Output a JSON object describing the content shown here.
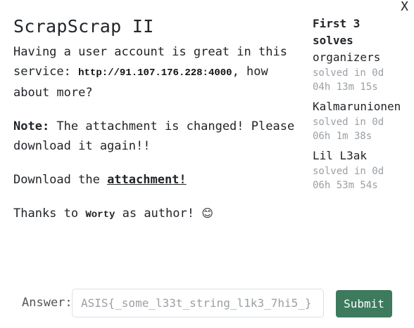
{
  "close_label": "X",
  "challenge": {
    "title": "ScrapScrap II",
    "intro_before": "Having a user account is great in this service: ",
    "service_url": "http://91.107.176.228:4000",
    "intro_after": ", how about more?",
    "note_label": "Note:",
    "note_text": " The attachment is changed! Please download it again!!",
    "download_before": "Download the ",
    "download_link": "attachment!",
    "thanks_before": "Thanks to ",
    "author": "Worty",
    "thanks_after": " as author! ",
    "emoji": "😊"
  },
  "solves": {
    "title": "First 3 solves",
    "list": [
      {
        "name": "organizers",
        "time": "solved in 0d 04h 13m 15s"
      },
      {
        "name": "Kalmarunionen",
        "time": "solved in 0d 06h 1m 38s"
      },
      {
        "name": "Lil L3ak",
        "time": "solved in 0d 06h 53m 54s"
      }
    ]
  },
  "answer": {
    "label": "Answer:",
    "placeholder": "ASIS{_some_l33t_string_l1k3_7hi5_}",
    "submit_label": "Submit"
  },
  "colors": {
    "submit_bg": "#3d7a5e",
    "muted_text": "#9aa0a6"
  }
}
